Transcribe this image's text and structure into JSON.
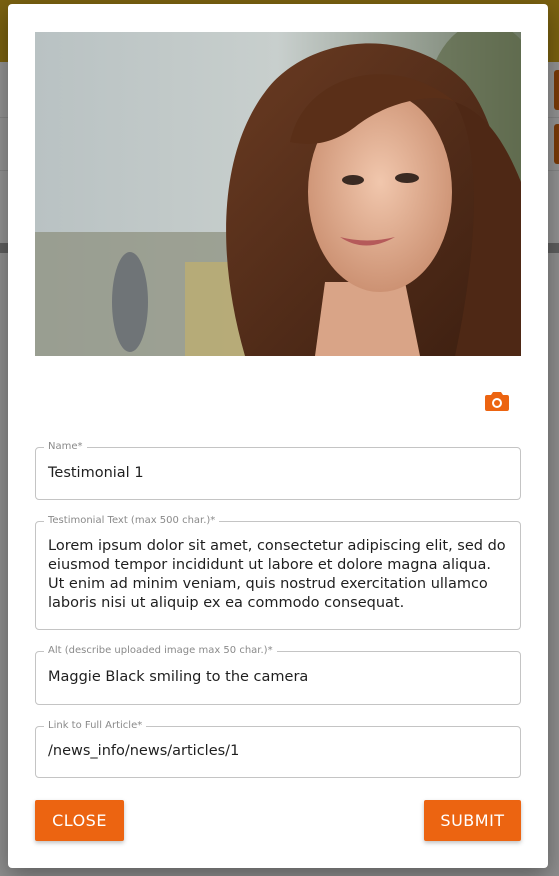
{
  "colors": {
    "accent": "#ec6411",
    "overlay": "#8f8f8f"
  },
  "modal": {
    "image_icon": "woman-portrait-photo",
    "camera_icon": "camera-icon",
    "fields": {
      "name": {
        "label": "Name*",
        "value": "Testimonial 1"
      },
      "testimonial": {
        "label": "Testimonial Text (max 500 char.)*",
        "value": "Lorem ipsum dolor sit amet, consectetur adipiscing elit, sed do eiusmod tempor incididunt ut labore et dolore magna aliqua. Ut enim ad minim veniam, quis nostrud exercitation ullamco laboris nisi ut aliquip ex ea commodo consequat."
      },
      "alt": {
        "label": "Alt (describe uploaded image max 50 char.)*",
        "value": "Maggie Black smiling to the camera"
      },
      "link": {
        "label": "Link to Full Article*",
        "value": "/news_info/news/articles/1"
      }
    },
    "buttons": {
      "close": "CLOSE",
      "submit": "SUBMIT"
    }
  }
}
